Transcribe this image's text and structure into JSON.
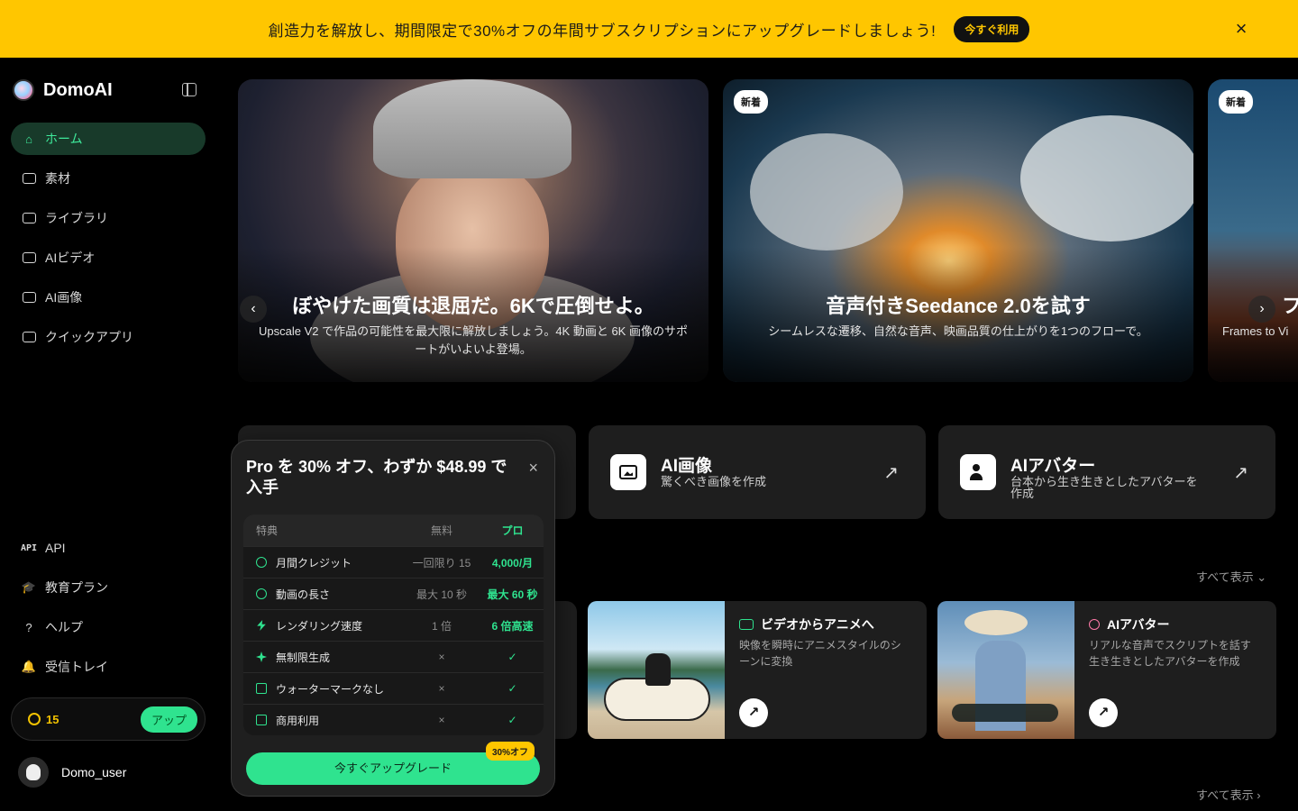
{
  "banner": {
    "text": "創造力を解放し、期間限定で30%オフの年間サブスクリプションにアップグレードしましょう!",
    "cta": "今すぐ利用",
    "close": "×"
  },
  "sidebar": {
    "brand": "DomoAI",
    "items": [
      {
        "label": "ホーム",
        "icon": "home-icon",
        "active": true
      },
      {
        "label": "素材",
        "icon": "assets-icon"
      },
      {
        "label": "ライブラリ",
        "icon": "library-icon"
      },
      {
        "label": "AIビデオ",
        "icon": "video-icon"
      },
      {
        "label": "AI画像",
        "icon": "image-icon"
      },
      {
        "label": "クイックアプリ",
        "icon": "quick-app-icon"
      }
    ],
    "bottom_items": [
      {
        "label": "API",
        "icon": "api-icon"
      },
      {
        "label": "教育プラン",
        "icon": "education-icon"
      },
      {
        "label": "ヘルプ",
        "icon": "help-icon"
      },
      {
        "label": "受信トレイ",
        "icon": "bell-icon"
      }
    ],
    "credits": "15",
    "upgrade": "アップ",
    "user": "Domo_user"
  },
  "hero": [
    {
      "title": "ぼやけた画質は退屈だ。6Kで圧倒せよ。",
      "sub": "Upscale V2 で作品の可能性を最大限に解放しましょう。4K 動画と 6K 画像のサポートがいよいよ登場。"
    },
    {
      "badge": "新着",
      "title": "音声付きSeedance 2.0を試す",
      "sub": "シームレスな遷移、自然な音声、映画品質の仕上がりを1つのフローで。"
    },
    {
      "badge": "新着",
      "title": "フ",
      "sub": "Frames to Vi"
    }
  ],
  "features": [
    {
      "title": "AI画像",
      "sub": "驚くべき画像を作成",
      "icon": "image-icon"
    },
    {
      "title": "AIアバター",
      "sub": "台本から生き生きとしたアバターを作成",
      "icon": "avatar-icon"
    }
  ],
  "see_all": "すべて表示",
  "apps": [
    {
      "title": "ビデオからアニメへ",
      "sub": "映像を瞬時にアニメスタイルのシーンに変換",
      "icon": "video-icon"
    },
    {
      "title": "AIアバター",
      "sub": "リアルな音声でスクリプトを話す生き生きとしたアバターを作成",
      "icon": "avatar-icon"
    }
  ],
  "popup": {
    "title": "Pro を 30% オフ、わずか $48.99 で入手",
    "close": "×",
    "headers": [
      "特典",
      "無料",
      "プロ"
    ],
    "rows": [
      {
        "feature": "月間クレジット",
        "free": "一回限り 15",
        "pro": "4,000/月",
        "icon": "credit-icon"
      },
      {
        "feature": "動画の長さ",
        "free": "最大 10 秒",
        "pro": "最大 60 秒",
        "icon": "clock-icon"
      },
      {
        "feature": "レンダリング速度",
        "free": "1 倍",
        "pro": "6 倍高速",
        "icon": "bolt-icon"
      },
      {
        "feature": "無制限生成",
        "free": "×",
        "pro": "✓",
        "icon": "sparkle-icon"
      },
      {
        "feature": "ウォーターマークなし",
        "free": "×",
        "pro": "✓",
        "icon": "watermark-icon"
      },
      {
        "feature": "商用利用",
        "free": "×",
        "pro": "✓",
        "icon": "commercial-icon"
      }
    ],
    "cta": "今すぐアップグレード",
    "discount": "30%オフ"
  },
  "colors": {
    "accent": "#2fe38f",
    "banner": "#FFC600",
    "card": "#1e1e1e"
  }
}
